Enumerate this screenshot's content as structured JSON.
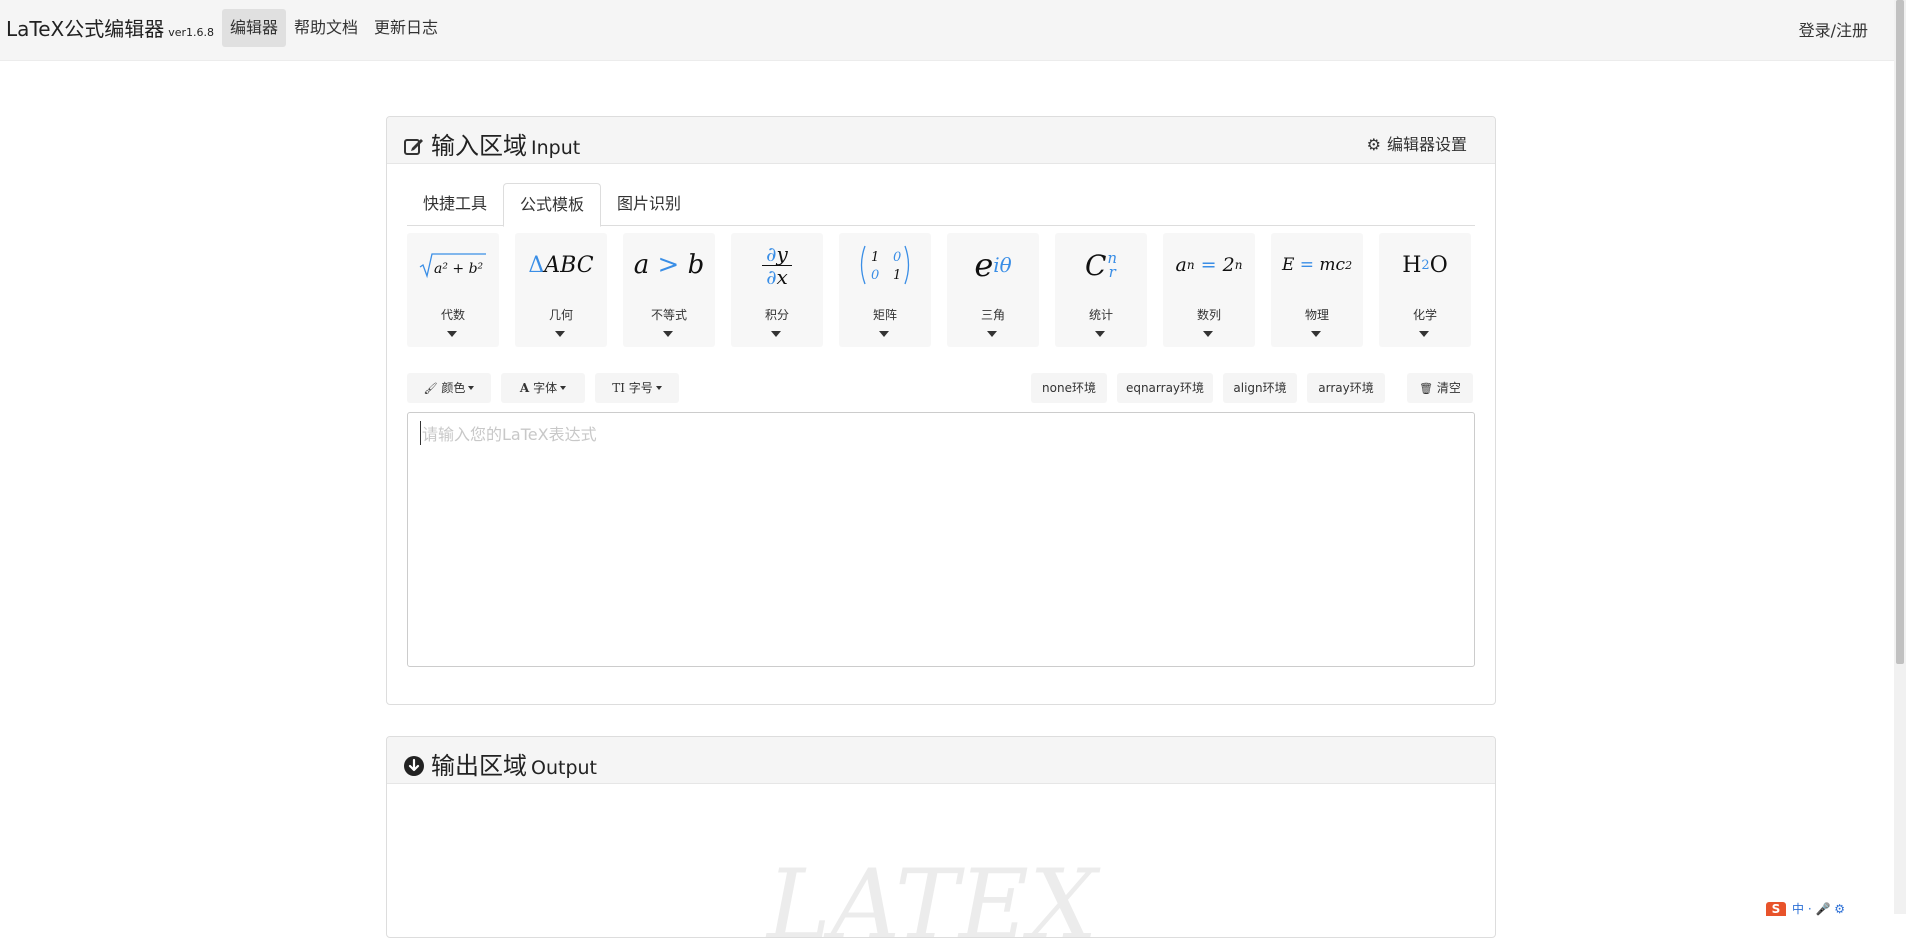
{
  "navbar": {
    "brand": "LaTeX公式编辑器",
    "version": "ver1.6.8",
    "items": [
      {
        "label": "编辑器",
        "active": true
      },
      {
        "label": "帮助文档",
        "active": false
      },
      {
        "label": "更新日志",
        "active": false
      }
    ],
    "login": "登录/注册"
  },
  "input_panel": {
    "title": "输入区域",
    "title_en": "Input",
    "settings_label": "编辑器设置",
    "tabs": [
      "快捷工具",
      "公式模板",
      "图片识别"
    ],
    "active_tab": "公式模板",
    "templates": [
      {
        "formula": "√(a²+b²)",
        "label": "代数"
      },
      {
        "formula": "ΔABC",
        "label": "几何"
      },
      {
        "formula": "a > b",
        "label": "不等式"
      },
      {
        "formula": "∂y/∂x",
        "label": "积分"
      },
      {
        "formula": "(1 0; 0 1)",
        "label": "矩阵"
      },
      {
        "formula": "e^{iθ}",
        "label": "三角"
      },
      {
        "formula": "C_r^n",
        "label": "统计"
      },
      {
        "formula": "a_n = 2^n",
        "label": "数列"
      },
      {
        "formula": "E = mc²",
        "label": "物理"
      },
      {
        "formula": "H₂O",
        "label": "化学"
      }
    ],
    "toolbar": {
      "color": "颜色",
      "font": "字体",
      "size": "字号",
      "env_none": "none环境",
      "env_eqnarray": "eqnarray环境",
      "env_align": "align环境",
      "env_array": "array环境",
      "clear": "清空"
    },
    "editor_placeholder": "请输入您的LaTeX表达式"
  },
  "output_panel": {
    "title": "输出区域",
    "title_en": "Output",
    "watermark": "LATEX"
  },
  "system_tray": {
    "ime_lang": "中"
  },
  "colors": {
    "accent_blue": "#3a8ee6",
    "navbar_bg": "#f5f5f5",
    "panel_header_bg": "#f5f5f5",
    "card_bg": "#f7f7f7"
  }
}
